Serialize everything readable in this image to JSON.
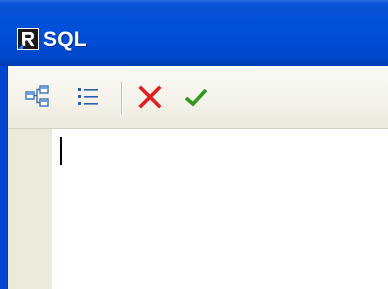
{
  "window": {
    "title": "SQL",
    "app_icon": "fastreport-r-icon"
  },
  "toolbar": {
    "buttons": [
      {
        "icon": "query-builder-icon"
      },
      {
        "icon": "params-list-icon"
      },
      {
        "icon": "cancel-x-icon",
        "color": "#e02020"
      },
      {
        "icon": "ok-check-icon",
        "color": "#2e9a1e"
      }
    ]
  },
  "editor": {
    "text": ""
  }
}
